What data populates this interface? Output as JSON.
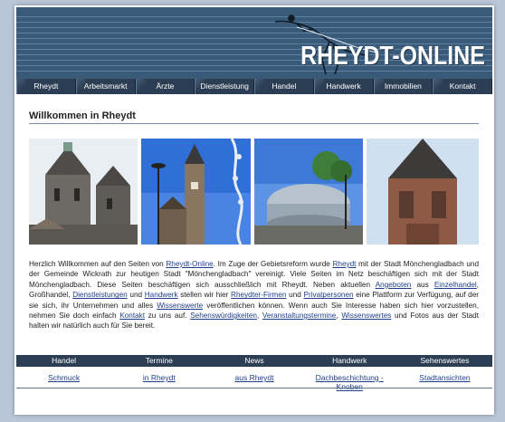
{
  "banner": {
    "title": "RHEYDT-ONLINE"
  },
  "nav": {
    "items": [
      "Rheydt",
      "Arbeitsmarkt",
      "Ärzte",
      "Dienstleistung",
      "Handel",
      "Handwerk",
      "Immobilien",
      "Kontakt"
    ]
  },
  "main": {
    "heading": "Willkommen in Rheydt",
    "photos": [
      "church-towers",
      "town-hall-tower",
      "modern-building",
      "church-spire"
    ],
    "intro": {
      "t1": "Herzlich Willkommen auf den Seiten von ",
      "l1": "Rheydt-Online",
      "t2": ". Im Zuge der Gebietsreform wurde ",
      "l2": "Rheydt",
      "t3": " mit der Stadt Mönchengladbach und der Gemeinde Wickrath zur heutigen Stadt \"Mönchengladbach\" vereinigt. Viele Seiten im Netz beschäftigen sich mit der Stadt Mönchengladbach. Diese Seiten beschäftigen sich ausschließlich mit Rheydt. Neben aktuellen ",
      "l3": "Angeboten",
      "t4": " aus ",
      "l4": "Einzelhandel",
      "t5": ", Großhandel, ",
      "l5": "Dienstleistungen",
      "t6": " und ",
      "l6": "Handwerk",
      "t7": " stellen wir hier ",
      "l7": "Rheydter-Firmen",
      "t8": " und ",
      "l8": "Privatpersonen",
      "t9": " eine Plattform zur Verfügung, auf der sie sich, ihr Unternehmen und alles ",
      "l9": "Wissenswerte",
      "t10": " veröffentlichen können. Wenn auch Sie Interesse haben sich hier vorzustellen, nehmen Sie doch einfach ",
      "l10": "Kontakt",
      "t11": " zu uns auf. ",
      "l11": "Sehenswürdigkeiten",
      "t12": ", ",
      "l12": "Veranstaltungstermine",
      "t13": ", ",
      "l13": "Wissenswertes",
      "t14": " und Fotos aus der Stadt halten wir natürlich auch für Sie bereit."
    }
  },
  "bottom": {
    "headers": [
      "Handel",
      "Termine",
      "News",
      "Handwerk",
      "Sehenswertes"
    ],
    "links": [
      "Schmuck",
      "in Rheydt",
      "aus Rheydt",
      "Dachbeschichtung - Knoben",
      "Stadtansichten"
    ]
  },
  "colors": {
    "banner": "#3a5a7a",
    "nav": "#2c3e53",
    "link": "#1e3f8a",
    "page_bg": "#b9c6d8"
  }
}
